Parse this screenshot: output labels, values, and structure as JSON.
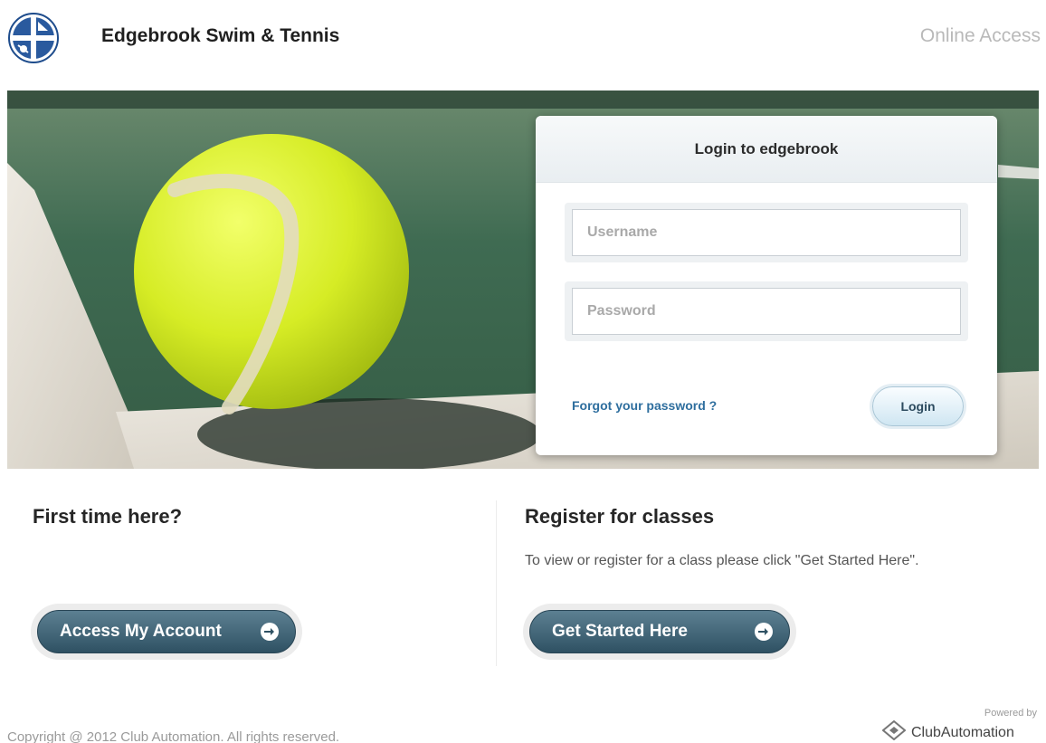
{
  "header": {
    "club_name": "Edgebrook Swim & Tennis",
    "online_access": "Online Access"
  },
  "login": {
    "title": "Login to edgebrook",
    "username_placeholder": "Username",
    "password_placeholder": "Password",
    "forgot_link": "Forgot your password ?",
    "login_button": "Login"
  },
  "first_time": {
    "title": "First time here?",
    "button_label": "Access My Account"
  },
  "register": {
    "title": "Register for classes",
    "description": "To view or register for a class please click \"Get Started Here\".",
    "button_label": "Get Started Here"
  },
  "footer": {
    "copyright": "Copyright @ 2012 Club Automation. All rights reserved.",
    "powered_by": "Powered by",
    "brand": "ClubAutomation"
  },
  "icons": {
    "logo": "club-logo-icon",
    "arrow": "arrow-right-icon",
    "brand": "clubautomation-logo-icon"
  },
  "colors": {
    "court_green": "#3e6d54",
    "button_teal": "#3a5d6f",
    "link_blue": "#2e6e9e",
    "ball_yellow": "#d8ef2a"
  }
}
